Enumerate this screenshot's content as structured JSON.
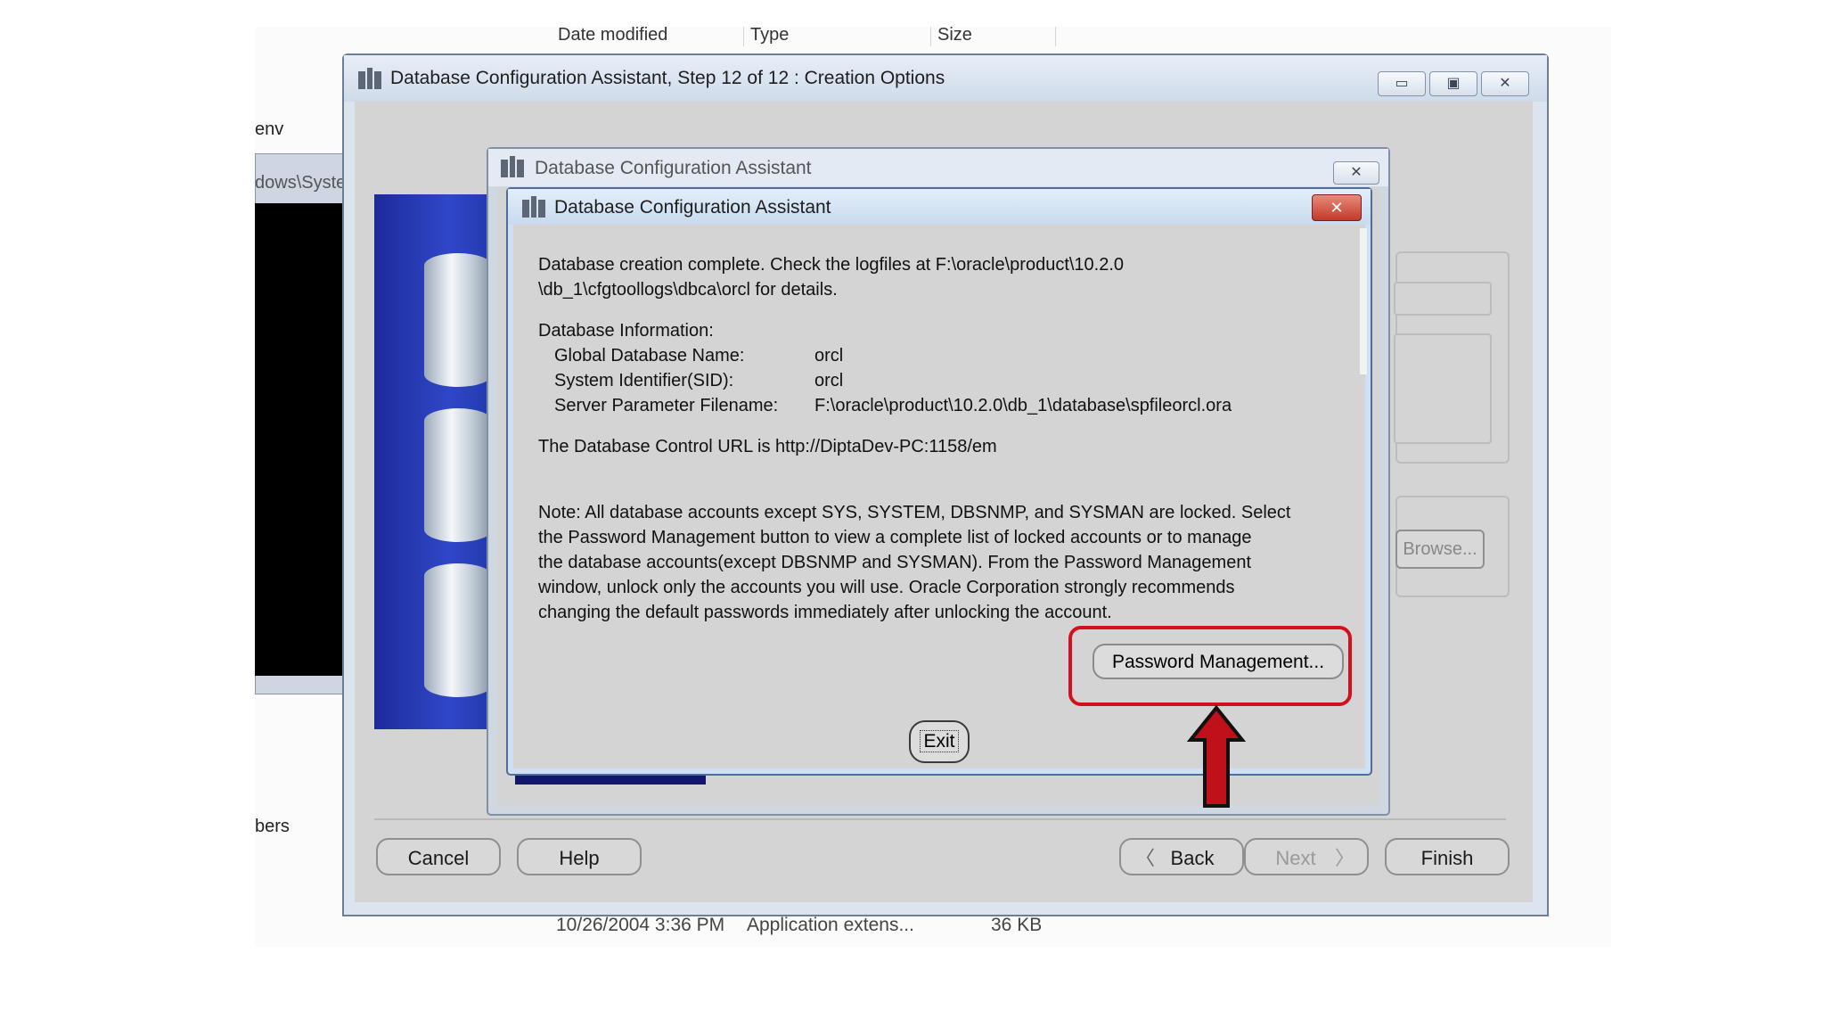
{
  "explorer": {
    "columns": [
      "Date modified",
      "Type",
      "Size"
    ],
    "left_snippets": [
      "env",
      "dows\\Syste",
      "bers"
    ],
    "bottom_row": {
      "date": "10/26/2004 3:36 PM",
      "type": "Application extens...",
      "size": "36 KB"
    }
  },
  "main_window": {
    "title": "Database Configuration Assistant, Step 12 of 12 : Creation Options",
    "browse_label": "Browse...",
    "buttons": {
      "cancel": "Cancel",
      "help": "Help",
      "back": "Back",
      "next": "Next",
      "finish": "Finish"
    }
  },
  "back_dialog": {
    "title": "Database Configuration Assistant"
  },
  "dialog": {
    "title": "Database Configuration Assistant",
    "close_glyph": "✕",
    "line1": "Database creation complete. Check the logfiles at F:\\oracle\\product\\10.2.0",
    "line2": "\\db_1\\cfgtoollogs\\dbca\\orcl for details.",
    "info_heading": "Database Information:",
    "info": [
      {
        "label": "Global Database Name:",
        "value": "orcl"
      },
      {
        "label": "System Identifier(SID):",
        "value": "orcl"
      },
      {
        "label": "Server Parameter Filename:",
        "value": "F:\\oracle\\product\\10.2.0\\db_1\\database\\spfileorcl.ora"
      }
    ],
    "url_line": "The Database Control URL is http://DiptaDev-PC:1158/em",
    "note_lines": [
      "Note: All database accounts except SYS, SYSTEM, DBSNMP, and SYSMAN are locked. Select",
      "the Password Management button to view a complete list of locked accounts or to manage",
      "the database accounts(except DBSNMP and SYSMAN). From the Password Management",
      "window, unlock only the accounts you will use. Oracle Corporation strongly recommends",
      "changing the default passwords immediately after unlocking the account."
    ],
    "password_button": "Password Management...",
    "exit_button": "Exit"
  },
  "colors": {
    "highlight": "#d4101c",
    "arrow": "#c0101a",
    "side_panel": "#2537b5"
  }
}
